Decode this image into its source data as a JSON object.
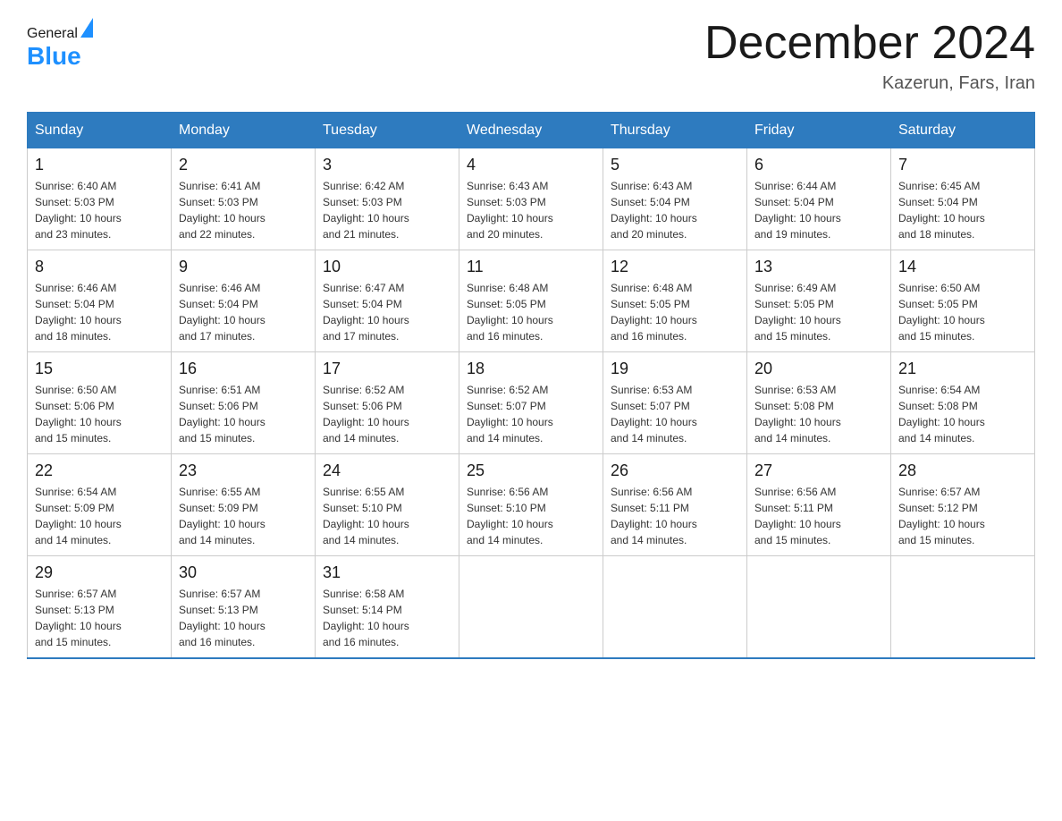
{
  "header": {
    "logo_text_general": "General",
    "logo_text_blue": "Blue",
    "month_title": "December 2024",
    "subtitle": "Kazerun, Fars, Iran"
  },
  "weekdays": [
    "Sunday",
    "Monday",
    "Tuesday",
    "Wednesday",
    "Thursday",
    "Friday",
    "Saturday"
  ],
  "weeks": [
    [
      {
        "day": "1",
        "sunrise": "6:40 AM",
        "sunset": "5:03 PM",
        "daylight": "10 hours and 23 minutes."
      },
      {
        "day": "2",
        "sunrise": "6:41 AM",
        "sunset": "5:03 PM",
        "daylight": "10 hours and 22 minutes."
      },
      {
        "day": "3",
        "sunrise": "6:42 AM",
        "sunset": "5:03 PM",
        "daylight": "10 hours and 21 minutes."
      },
      {
        "day": "4",
        "sunrise": "6:43 AM",
        "sunset": "5:03 PM",
        "daylight": "10 hours and 20 minutes."
      },
      {
        "day": "5",
        "sunrise": "6:43 AM",
        "sunset": "5:04 PM",
        "daylight": "10 hours and 20 minutes."
      },
      {
        "day": "6",
        "sunrise": "6:44 AM",
        "sunset": "5:04 PM",
        "daylight": "10 hours and 19 minutes."
      },
      {
        "day": "7",
        "sunrise": "6:45 AM",
        "sunset": "5:04 PM",
        "daylight": "10 hours and 18 minutes."
      }
    ],
    [
      {
        "day": "8",
        "sunrise": "6:46 AM",
        "sunset": "5:04 PM",
        "daylight": "10 hours and 18 minutes."
      },
      {
        "day": "9",
        "sunrise": "6:46 AM",
        "sunset": "5:04 PM",
        "daylight": "10 hours and 17 minutes."
      },
      {
        "day": "10",
        "sunrise": "6:47 AM",
        "sunset": "5:04 PM",
        "daylight": "10 hours and 17 minutes."
      },
      {
        "day": "11",
        "sunrise": "6:48 AM",
        "sunset": "5:05 PM",
        "daylight": "10 hours and 16 minutes."
      },
      {
        "day": "12",
        "sunrise": "6:48 AM",
        "sunset": "5:05 PM",
        "daylight": "10 hours and 16 minutes."
      },
      {
        "day": "13",
        "sunrise": "6:49 AM",
        "sunset": "5:05 PM",
        "daylight": "10 hours and 15 minutes."
      },
      {
        "day": "14",
        "sunrise": "6:50 AM",
        "sunset": "5:05 PM",
        "daylight": "10 hours and 15 minutes."
      }
    ],
    [
      {
        "day": "15",
        "sunrise": "6:50 AM",
        "sunset": "5:06 PM",
        "daylight": "10 hours and 15 minutes."
      },
      {
        "day": "16",
        "sunrise": "6:51 AM",
        "sunset": "5:06 PM",
        "daylight": "10 hours and 15 minutes."
      },
      {
        "day": "17",
        "sunrise": "6:52 AM",
        "sunset": "5:06 PM",
        "daylight": "10 hours and 14 minutes."
      },
      {
        "day": "18",
        "sunrise": "6:52 AM",
        "sunset": "5:07 PM",
        "daylight": "10 hours and 14 minutes."
      },
      {
        "day": "19",
        "sunrise": "6:53 AM",
        "sunset": "5:07 PM",
        "daylight": "10 hours and 14 minutes."
      },
      {
        "day": "20",
        "sunrise": "6:53 AM",
        "sunset": "5:08 PM",
        "daylight": "10 hours and 14 minutes."
      },
      {
        "day": "21",
        "sunrise": "6:54 AM",
        "sunset": "5:08 PM",
        "daylight": "10 hours and 14 minutes."
      }
    ],
    [
      {
        "day": "22",
        "sunrise": "6:54 AM",
        "sunset": "5:09 PM",
        "daylight": "10 hours and 14 minutes."
      },
      {
        "day": "23",
        "sunrise": "6:55 AM",
        "sunset": "5:09 PM",
        "daylight": "10 hours and 14 minutes."
      },
      {
        "day": "24",
        "sunrise": "6:55 AM",
        "sunset": "5:10 PM",
        "daylight": "10 hours and 14 minutes."
      },
      {
        "day": "25",
        "sunrise": "6:56 AM",
        "sunset": "5:10 PM",
        "daylight": "10 hours and 14 minutes."
      },
      {
        "day": "26",
        "sunrise": "6:56 AM",
        "sunset": "5:11 PM",
        "daylight": "10 hours and 14 minutes."
      },
      {
        "day": "27",
        "sunrise": "6:56 AM",
        "sunset": "5:11 PM",
        "daylight": "10 hours and 15 minutes."
      },
      {
        "day": "28",
        "sunrise": "6:57 AM",
        "sunset": "5:12 PM",
        "daylight": "10 hours and 15 minutes."
      }
    ],
    [
      {
        "day": "29",
        "sunrise": "6:57 AM",
        "sunset": "5:13 PM",
        "daylight": "10 hours and 15 minutes."
      },
      {
        "day": "30",
        "sunrise": "6:57 AM",
        "sunset": "5:13 PM",
        "daylight": "10 hours and 16 minutes."
      },
      {
        "day": "31",
        "sunrise": "6:58 AM",
        "sunset": "5:14 PM",
        "daylight": "10 hours and 16 minutes."
      },
      null,
      null,
      null,
      null
    ]
  ],
  "labels": {
    "sunrise": "Sunrise:",
    "sunset": "Sunset:",
    "daylight": "Daylight:"
  }
}
